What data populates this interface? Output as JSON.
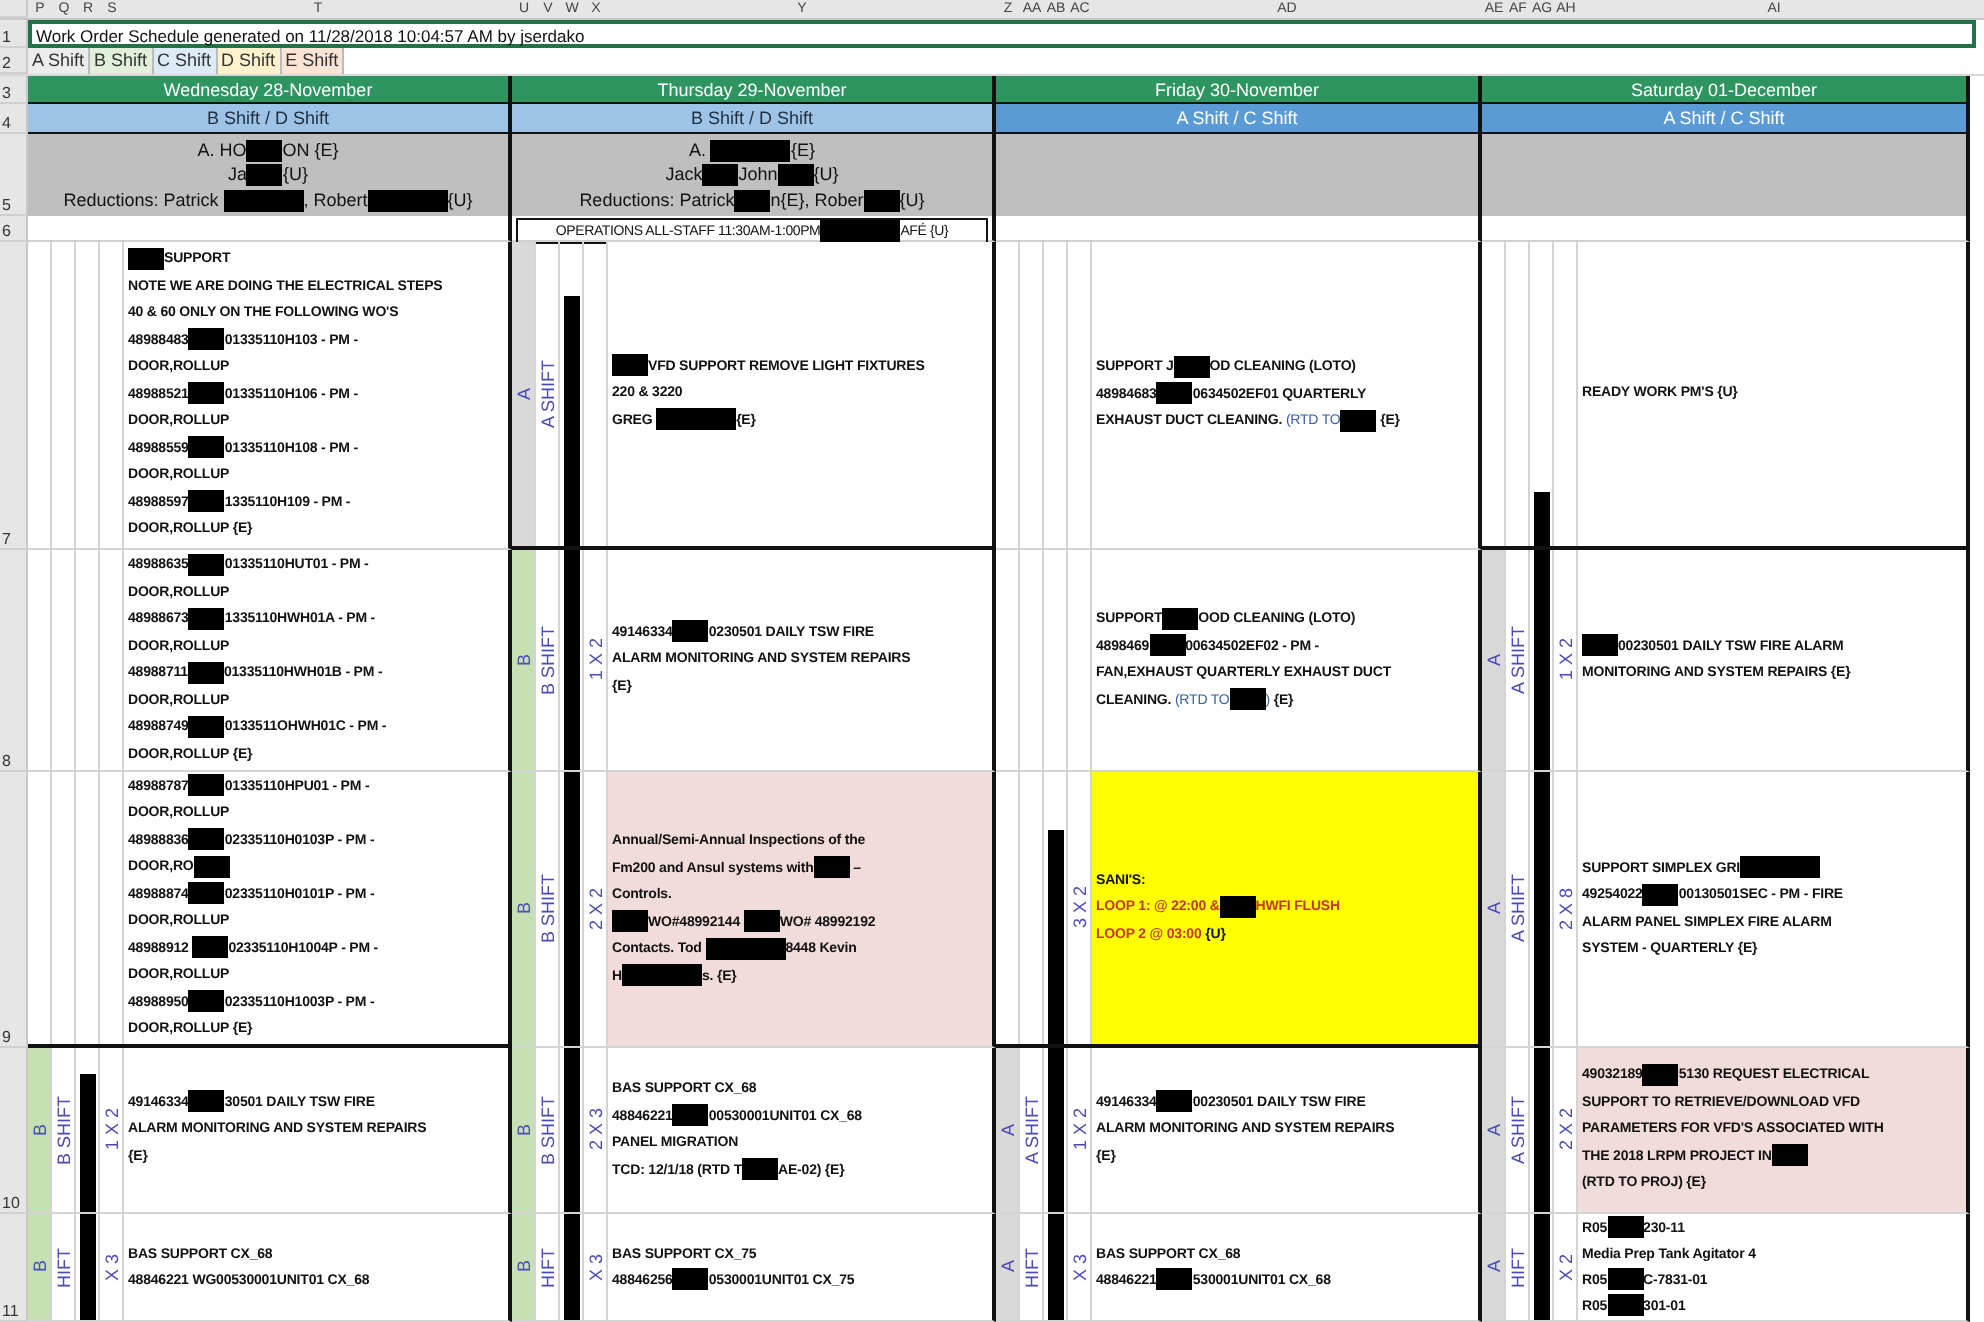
{
  "column_headers": [
    {
      "narrow": [
        "P",
        "Q",
        "R",
        "S"
      ],
      "main": "T"
    },
    {
      "narrow": [
        "U",
        "V",
        "W",
        "X"
      ],
      "main": "Y"
    },
    {
      "narrow": [
        "Z",
        "AA",
        "AB",
        "AC"
      ],
      "main": "AD"
    },
    {
      "narrow": [
        "AE",
        "AF",
        "AG",
        "AH"
      ],
      "main": "AI"
    }
  ],
  "row_numbers": [
    "1",
    "2",
    "3",
    "4",
    "5",
    "6",
    "7",
    "8",
    "9",
    "10",
    "11"
  ],
  "title": {
    "text": "Work Order Schedule generated on 11/28/2018 10:04:57 AM by jserdako",
    "selected": true
  },
  "shift_legend": [
    {
      "label": "A Shift",
      "color": "#ececec"
    },
    {
      "label": "B Shift",
      "color": "#e2efda"
    },
    {
      "label": "C Shift",
      "color": "#ddebf7"
    },
    {
      "label": "D Shift",
      "color": "#fff2cc"
    },
    {
      "label": "E Shift",
      "color": "#fce4d6"
    }
  ],
  "days": [
    {
      "day": "Wednesday 28-November",
      "shifts": {
        "text": "B Shift / D Shift",
        "color": "#9dc3e6"
      },
      "crew_lines": [
        [
          "A. HO",
          {
            "kind": "redaction"
          },
          "ON {E}"
        ],
        [
          "Ja",
          {
            "kind": "redaction"
          },
          "{U}"
        ],
        [
          "Reductions: Patrick ",
          {
            "kind": "long-redaction"
          },
          ", Robert",
          {
            "kind": "long-redaction"
          },
          "{U}"
        ]
      ],
      "slots": [
        {
          "group_end": false,
          "lines": [
            [
              {
                "kind": "redaction"
              },
              "SUPPORT"
            ],
            [
              "NOTE WE ARE DOING THE ELECTRICAL STEPS"
            ],
            [
              "40 & 60 ONLY ON THE FOLLOWING WO'S"
            ],
            [
              "48988483",
              {
                "kind": "redaction"
              },
              "01335110H103 - PM -"
            ],
            [
              "DOOR,ROLLUP"
            ],
            [
              "48988521",
              {
                "kind": "redaction"
              },
              "01335110H106 - PM -"
            ],
            [
              "DOOR,ROLLUP"
            ],
            [
              "48988559",
              {
                "kind": "redaction"
              },
              "01335110H108 - PM -"
            ],
            [
              "DOOR,ROLLUP"
            ],
            [
              "48988597",
              {
                "kind": "redaction"
              },
              "1335110H109 - PM -"
            ],
            [
              "DOOR,ROLLUP {E}"
            ]
          ]
        },
        {
          "group_end": false,
          "lines": [
            [
              "48988635",
              {
                "kind": "redaction"
              },
              "01335110HUT01 - PM -"
            ],
            [
              "DOOR,ROLLUP"
            ],
            [
              "48988673",
              {
                "kind": "redaction"
              },
              "1335110HWH01A - PM -"
            ],
            [
              "DOOR,ROLLUP"
            ],
            [
              "48988711",
              {
                "kind": "redaction"
              },
              "01335110HWH01B - PM -"
            ],
            [
              "DOOR,ROLLUP"
            ],
            [
              "48988749",
              {
                "kind": "redaction"
              },
              "0133511OHWH01C - PM -"
            ],
            [
              "DOOR,ROLLUP {E}"
            ]
          ]
        },
        {
          "group_end": true,
          "lines": [
            [
              "48988787",
              {
                "kind": "redaction"
              },
              "01335110HPU01 - PM -"
            ],
            [
              "DOOR,ROLLUP"
            ],
            [
              "48988836",
              {
                "kind": "redaction"
              },
              "02335110H0103P - PM -"
            ],
            [
              "DOOR,RO",
              {
                "kind": "redaction"
              }
            ],
            [
              "48988874",
              {
                "kind": "redaction"
              },
              "02335110H0101P - PM -"
            ],
            [
              "DOOR,ROLLUP"
            ],
            [
              "48988912 ",
              {
                "kind": "redaction"
              },
              "02335110H1004P - PM -"
            ],
            [
              "DOOR,ROLLUP"
            ],
            [
              "48988950",
              {
                "kind": "redaction"
              },
              "02335110H1003P - PM -"
            ],
            [
              "DOOR,ROLLUP {E}"
            ]
          ]
        },
        {
          "shift_band": {
            "letter": "B",
            "color": "#c6e0b4"
          },
          "shift_name": "B SHIFT",
          "crew": "1 X 2",
          "level": 0.84,
          "group_end": false,
          "lines": [
            [
              "49146334",
              {
                "kind": "redaction"
              },
              "30501 DAILY TSW FIRE"
            ],
            [
              "ALARM MONITORING AND SYSTEM REPAIRS"
            ],
            [
              "{E}"
            ]
          ]
        },
        {
          "shift_band": {
            "letter": "B",
            "color": "#c6e0b4"
          },
          "shift_name": "HIFT",
          "crew": "X 3",
          "level": 1,
          "group_end": false,
          "lines": [
            [
              "BAS SUPPORT CX_68"
            ],
            [
              "48846221 WG00530001UNIT01 CX_68"
            ]
          ]
        }
      ]
    },
    {
      "day": "Thursday 29-November",
      "shifts": {
        "text": "B Shift / D Shift",
        "color": "#9dc3e6"
      },
      "crew_lines": [
        [
          "A. ",
          {
            "kind": "long-redaction"
          },
          "{E}"
        ],
        [
          "Jack",
          {
            "kind": "redaction"
          },
          "John",
          {
            "kind": "redaction"
          },
          "{U}"
        ],
        [
          "Reductions: Patrick",
          {
            "kind": "redaction"
          },
          "n{E}, Rober",
          {
            "kind": "redaction"
          },
          "{U}"
        ]
      ],
      "notice": [
        "OPERATIONS ALL-STAFF 11:30AM-1:00PM",
        {
          "kind": "long-redaction"
        },
        "AFÉ {U}"
      ],
      "slots": [
        {
          "shift_band": {
            "letter": "A",
            "color": "#d9d9d9"
          },
          "shift_name": "A SHIFT",
          "level": 0.82,
          "group_end": true,
          "lines": [
            [
              {
                "kind": "redaction"
              },
              "VFD SUPPORT REMOVE LIGHT FIXTURES"
            ],
            [
              "220 & 3220"
            ],
            [
              "GREG ",
              {
                "kind": "long-redaction"
              },
              "{E}"
            ]
          ]
        },
        {
          "shift_band": {
            "letter": "B",
            "color": "#c6e0b4"
          },
          "shift_name": "B SHIFT",
          "crew": "1 X 2",
          "level": 1,
          "group_end": false,
          "lines": [
            [
              "49146334",
              {
                "kind": "redaction"
              },
              "0230501 DAILY TSW FIRE"
            ],
            [
              "ALARM MONITORING AND SYSTEM REPAIRS"
            ],
            [
              "{E}"
            ]
          ]
        },
        {
          "shift_band": {
            "letter": "B",
            "color": "#c6e0b4"
          },
          "shift_name": "B SHIFT",
          "crew": "2 X 2",
          "level": 1,
          "group_end": false,
          "color": "#f2dcdb",
          "lines": [
            [
              "Annual/Semi-Annual Inspections of the"
            ],
            [
              "Fm200 and Ansul systems with",
              {
                "kind": "redaction"
              },
              " –"
            ],
            [
              "Controls."
            ],
            [
              {
                "kind": "redaction"
              },
              "WO#48992144 ",
              {
                "kind": "redaction"
              },
              "WO# 48992192"
            ],
            [
              "Contacts. Tod ",
              {
                "kind": "long-redaction"
              },
              "8448 Kevin"
            ],
            [
              "H",
              {
                "kind": "long-redaction"
              },
              "s. {E}"
            ]
          ]
        },
        {
          "shift_band": {
            "letter": "B",
            "color": "#c6e0b4"
          },
          "shift_name": "B SHIFT",
          "crew": "2 X 3",
          "level": 1,
          "group_end": false,
          "lines": [
            [
              "BAS SUPPORT CX_68"
            ],
            [
              "48846221",
              {
                "kind": "redaction"
              },
              "00530001UNIT01 CX_68"
            ],
            [
              "PANEL MIGRATION"
            ],
            [
              "TCD: 12/1/18 (RTD T",
              {
                "kind": "redaction"
              },
              "AE-02) {E}"
            ]
          ]
        },
        {
          "shift_band": {
            "letter": "B",
            "color": "#c6e0b4"
          },
          "shift_name": "HIFT",
          "crew": "X 3",
          "level": 1,
          "group_end": false,
          "lines": [
            [
              "BAS SUPPORT CX_75"
            ],
            [
              "48846256",
              {
                "kind": "redaction"
              },
              "0530001UNIT01 CX_75"
            ]
          ]
        }
      ]
    },
    {
      "day": "Friday 30-November",
      "shifts": {
        "text": "A Shift / C Shift",
        "color": "#5b9bd5"
      },
      "slots": [
        {
          "group_end": false,
          "lines": [
            [
              "SUPPORT J",
              {
                "kind": "redaction"
              },
              "OD CLEANING (LOTO)"
            ],
            [
              "48984683",
              {
                "kind": "redaction"
              },
              "0634502EF01 QUARTERLY"
            ],
            [
              "EXHAUST DUCT CLEANING. ",
              {
                "kind": "blue",
                "text": "(RTD TO"
              },
              {
                "kind": "redaction"
              },
              " {E}"
            ]
          ]
        },
        {
          "group_end": false,
          "lines": [
            [
              "SUPPORT",
              {
                "kind": "redaction"
              },
              "OOD CLEANING (LOTO)"
            ],
            [
              "4898469",
              {
                "kind": "redaction"
              },
              "00634502EF02 - PM -"
            ],
            [
              "FAN,EXHAUST QUARTERLY EXHAUST DUCT"
            ],
            [
              "CLEANING. ",
              {
                "kind": "blue",
                "text": "(RTD TO"
              },
              {
                "kind": "redaction"
              },
              {
                "kind": "blue",
                "text": ")"
              },
              " {E}"
            ]
          ]
        },
        {
          "crew": "3 X 2",
          "level": 0.79,
          "group_end": true,
          "color": "#ffff00",
          "lines": [
            [
              "SANI'S:"
            ],
            [
              {
                "kind": "red",
                "text": "LOOP 1: @  22:00 &"
              },
              {
                "kind": "redaction"
              },
              {
                "kind": "red",
                "text": "HWFI FLUSH"
              }
            ],
            [
              {
                "kind": "red",
                "text": "LOOP 2 @ 03:00"
              },
              " {U}"
            ]
          ]
        },
        {
          "shift_band": {
            "letter": "A",
            "color": "#d9d9d9"
          },
          "shift_name": "A SHIFT",
          "crew": "1 X 2",
          "level": 1,
          "group_end": false,
          "lines": [
            [
              "49146334",
              {
                "kind": "redaction"
              },
              "00230501 DAILY TSW FIRE"
            ],
            [
              "ALARM MONITORING AND SYSTEM REPAIRS"
            ],
            [
              "{E}"
            ]
          ]
        },
        {
          "shift_band": {
            "letter": "A",
            "color": "#d9d9d9"
          },
          "shift_name": "HIFT",
          "crew": "X 3",
          "level": 1,
          "group_end": false,
          "lines": [
            [
              "BAS SUPPORT CX_68"
            ],
            [
              "48846221",
              {
                "kind": "redaction"
              },
              "530001UNIT01 CX_68"
            ]
          ]
        }
      ]
    },
    {
      "day": "Saturday 01-December",
      "shifts": {
        "text": "A Shift / C Shift",
        "color": "#5b9bd5"
      },
      "slots": [
        {
          "level": 0.18,
          "group_end": true,
          "lines": [
            [
              "READY WORK PM'S {U}"
            ]
          ]
        },
        {
          "shift_band": {
            "letter": "A",
            "color": "#d9d9d9"
          },
          "shift_name": "A SHIFT",
          "crew": "1 X 2",
          "level": 1,
          "group_end": false,
          "lines": [
            [
              {
                "kind": "redaction"
              },
              "00230501 DAILY TSW FIRE ALARM"
            ],
            [
              "MONITORING AND SYSTEM REPAIRS {E}"
            ]
          ]
        },
        {
          "shift_band": {
            "letter": "A",
            "color": "#d9d9d9"
          },
          "shift_name": "A SHIFT",
          "crew": "2 X 8",
          "level": 1,
          "group_end": false,
          "lines": [
            [
              "SUPPORT SIMPLEX GRI",
              {
                "kind": "long-redaction"
              }
            ],
            [
              "49254022",
              {
                "kind": "redaction"
              },
              "00130501SEC - PM - FIRE"
            ],
            [
              "ALARM PANEL SIMPLEX FIRE ALARM"
            ],
            [
              "SYSTEM - QUARTERLY {E}"
            ]
          ]
        },
        {
          "shift_band": {
            "letter": "A",
            "color": "#d9d9d9"
          },
          "shift_name": "A SHIFT",
          "crew": "2 X 2",
          "level": 1,
          "group_end": false,
          "color": "#f2dcdb",
          "lines": [
            [
              "49032189",
              {
                "kind": "redaction"
              },
              "5130 REQUEST ELECTRICAL"
            ],
            [
              "SUPPORT TO RETRIEVE/DOWNLOAD VFD"
            ],
            [
              "PARAMETERS FOR VFD'S ASSOCIATED WITH"
            ],
            [
              "THE 2018 LRPM PROJECT IN",
              {
                "kind": "redaction"
              }
            ],
            [
              "(RTD TO PROJ) {E}"
            ]
          ]
        },
        {
          "shift_band": {
            "letter": "A",
            "color": "#d9d9d9"
          },
          "shift_name": "HIFT",
          "crew": "X 2",
          "level": 1,
          "group_end": false,
          "lines": [
            [
              "R05",
              {
                "kind": "redaction"
              },
              "230-11"
            ],
            [
              "Media Prep Tank Agitator 4"
            ],
            [
              "R05",
              {
                "kind": "redaction"
              },
              "C-7831-01"
            ],
            [
              "R05",
              {
                "kind": "redaction"
              },
              "301-01"
            ]
          ]
        }
      ]
    }
  ]
}
